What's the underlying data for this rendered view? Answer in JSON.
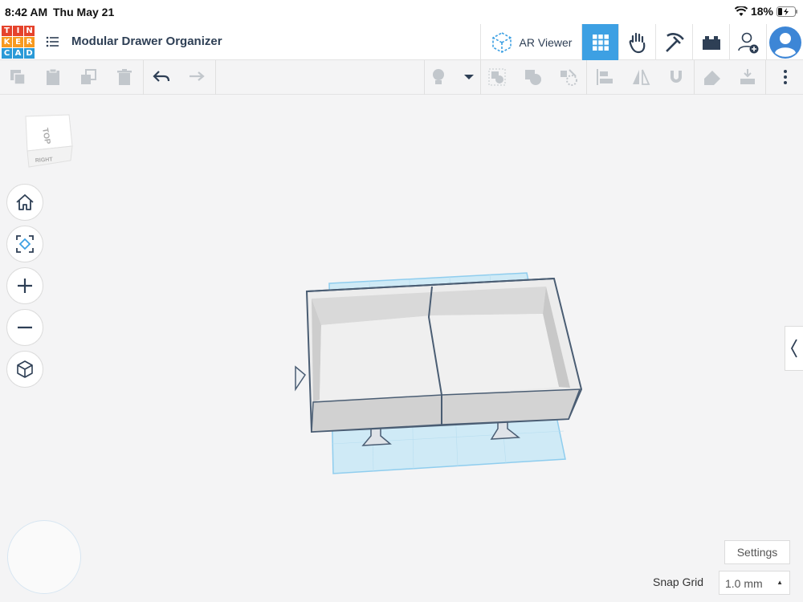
{
  "status_bar": {
    "time": "8:42 AM",
    "date": "Thu May 21",
    "battery": "18%"
  },
  "header": {
    "logo_letters": [
      "T",
      "I",
      "N",
      "K",
      "E",
      "R",
      "C",
      "A",
      "D"
    ],
    "logo_colors": [
      "#e5432c",
      "#e5432c",
      "#e5432c",
      "#f79a1f",
      "#f79a1f",
      "#f79a1f",
      "#2a9ad7",
      "#2a9ad7",
      "#2a9ad7"
    ],
    "title": "Modular Drawer Organizer",
    "ar_viewer_label": "AR Viewer"
  },
  "controls": {
    "settings_label": "Settings",
    "snap_grid_label": "Snap Grid",
    "snap_grid_value": "1.0 mm"
  },
  "view_cube": {
    "top_label": "TOP",
    "right_label": "RIGHT"
  },
  "colors": {
    "accent": "#3da0e3",
    "icon": "#2e3f55",
    "icon_disabled": "#c2c7cc",
    "workplane": "#cfeaf6"
  }
}
